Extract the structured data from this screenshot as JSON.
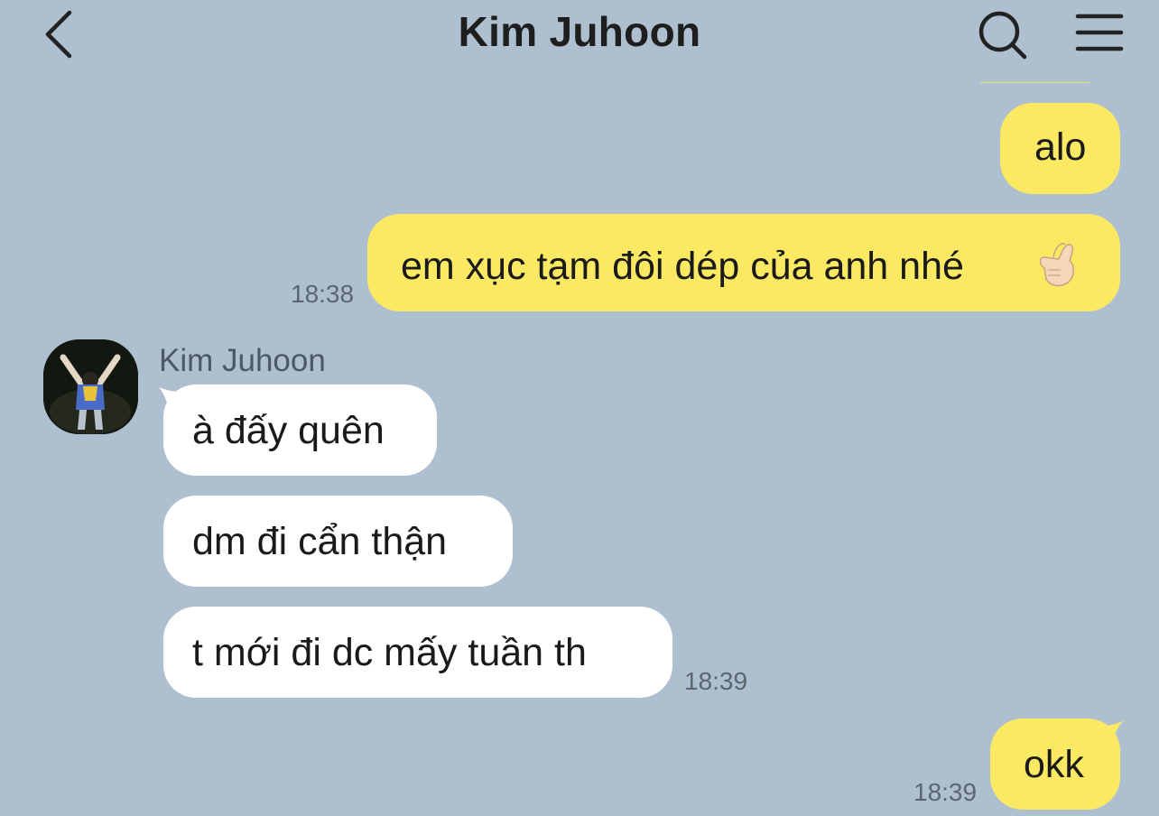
{
  "header": {
    "title": "Kim Juhoon"
  },
  "icons": {
    "back": "chevron-left-icon",
    "search": "search-icon",
    "menu": "hamburger-menu-icon",
    "reaction": "finger-heart-emoji"
  },
  "colors": {
    "background": "#aec0d0",
    "outgoing_bubble": "#fbe964",
    "incoming_bubble": "#ffffff",
    "timestamp": "#5b6670"
  },
  "messages": [
    {
      "from": "me",
      "text": "alo"
    },
    {
      "from": "me",
      "text": "em xục tạm đôi dép của anh nhé",
      "emoji": "finger-heart",
      "time": "18:38"
    },
    {
      "from": "them",
      "sender": "Kim Juhoon",
      "text": "à đấy quên"
    },
    {
      "from": "them",
      "text": "dm đi cẩn thận"
    },
    {
      "from": "them",
      "text": "t mới đi dc mấy tuần th",
      "time": "18:39"
    },
    {
      "from": "me",
      "text": "okk",
      "time": "18:39"
    }
  ]
}
